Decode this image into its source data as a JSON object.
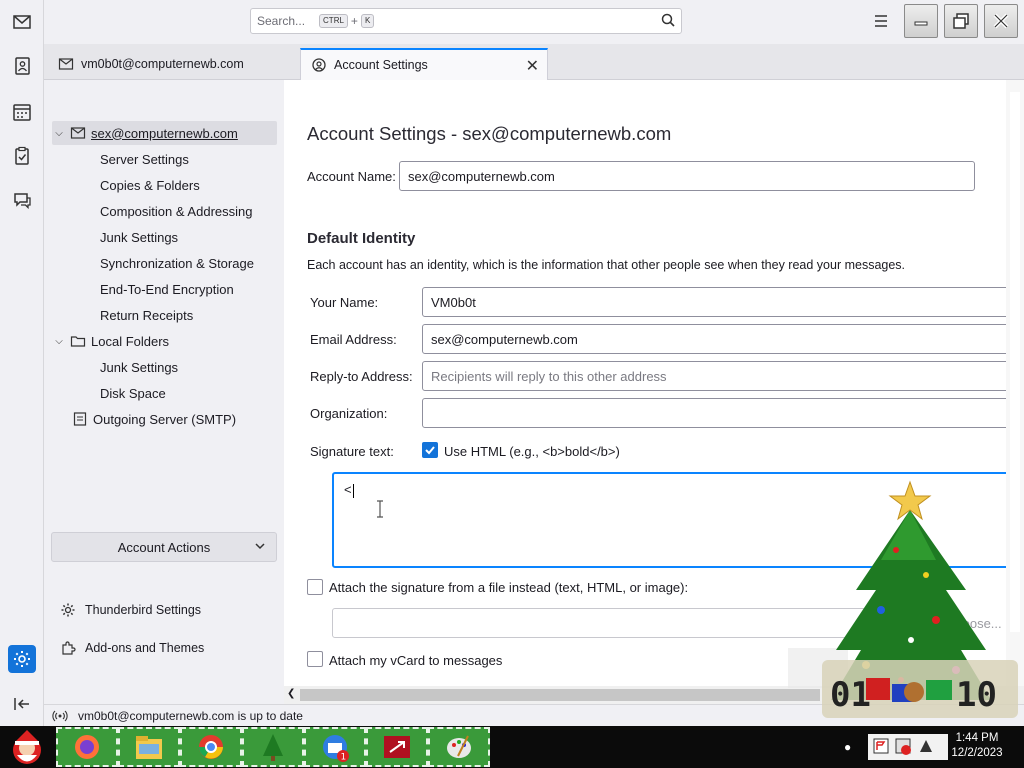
{
  "titlebar": {
    "search_placeholder": "Search...",
    "shortcut_ctrl": "CTRL",
    "shortcut_plus": "+",
    "shortcut_key": "K"
  },
  "tabs": [
    {
      "label": "vm0b0t@computernewb.com"
    },
    {
      "label": "Account Settings"
    }
  ],
  "nav": {
    "account": "sex@computernewb.com",
    "account_items": [
      "Server Settings",
      "Copies & Folders",
      "Composition & Addressing",
      "Junk Settings",
      "Synchronization & Storage",
      "End-To-End Encryption",
      "Return Receipts"
    ],
    "local_folders": "Local Folders",
    "local_items": [
      "Junk Settings",
      "Disk Space"
    ],
    "outgoing": "Outgoing Server (SMTP)",
    "account_actions": "Account Actions",
    "thunderbird_settings": "Thunderbird Settings",
    "addons": "Add-ons and Themes"
  },
  "content": {
    "heading": "Account Settings - sex@computernewb.com",
    "account_name_label": "Account Name:",
    "account_name_value": "sex@computernewb.com",
    "default_identity": "Default Identity",
    "identity_desc": "Each account has an identity, which is the information that other people see when they read your messages.",
    "your_name_label": "Your Name:",
    "your_name_value": "VM0b0t",
    "email_label": "Email Address:",
    "email_value": "sex@computernewb.com",
    "reply_label": "Reply-to Address:",
    "reply_placeholder": "Recipients will reply to this other address",
    "org_label": "Organization:",
    "org_value": "",
    "sig_label": "Signature text:",
    "use_html_label": "Use HTML (e.g., <b>bold</b>)",
    "use_html_checked": true,
    "signature_value": "<",
    "attach_file_label": "Attach the signature from a file instead (text, HTML, or image):",
    "choose_label": "Choose...",
    "vcard_label": "Attach my vCard to messages"
  },
  "status": {
    "text": "vm0b0t@computernewb.com is up to date"
  },
  "taskbar": {
    "time": "1:44 PM",
    "date": "12/2/2023"
  },
  "colors": {
    "accent": "#1373d9",
    "focus": "#0a84ff"
  }
}
